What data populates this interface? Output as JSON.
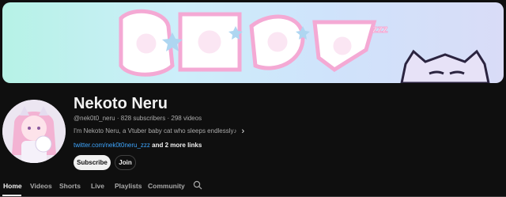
{
  "banner": {
    "title_art": "猫戸ネル",
    "zzz": "zzz"
  },
  "channel": {
    "name": "Nekoto Neru",
    "handle": "@nek0t0_neru",
    "subscribers": "828 subscribers",
    "videos": "298 videos",
    "separator": "·",
    "description": "I'm Nekoto Neru, a Vtuber baby cat who sleeps endlessly♪",
    "more_icon": "chevron-right-icon",
    "link_url": "twitter.com/nek0t0neru_zzz",
    "more_links": "and 2 more links"
  },
  "buttons": {
    "subscribe": "Subscribe",
    "join": "Join"
  },
  "tabs": [
    {
      "label": "Home",
      "active": true
    },
    {
      "label": "Videos"
    },
    {
      "label": "Shorts"
    },
    {
      "label": "Live"
    },
    {
      "label": "Playlists"
    },
    {
      "label": "Community"
    }
  ],
  "tab_search_icon": "search-icon",
  "colors": {
    "link": "#3ea6ff",
    "background": "#0f0f0f",
    "text": "#f1f1f1",
    "muted": "#aaaaaa"
  }
}
